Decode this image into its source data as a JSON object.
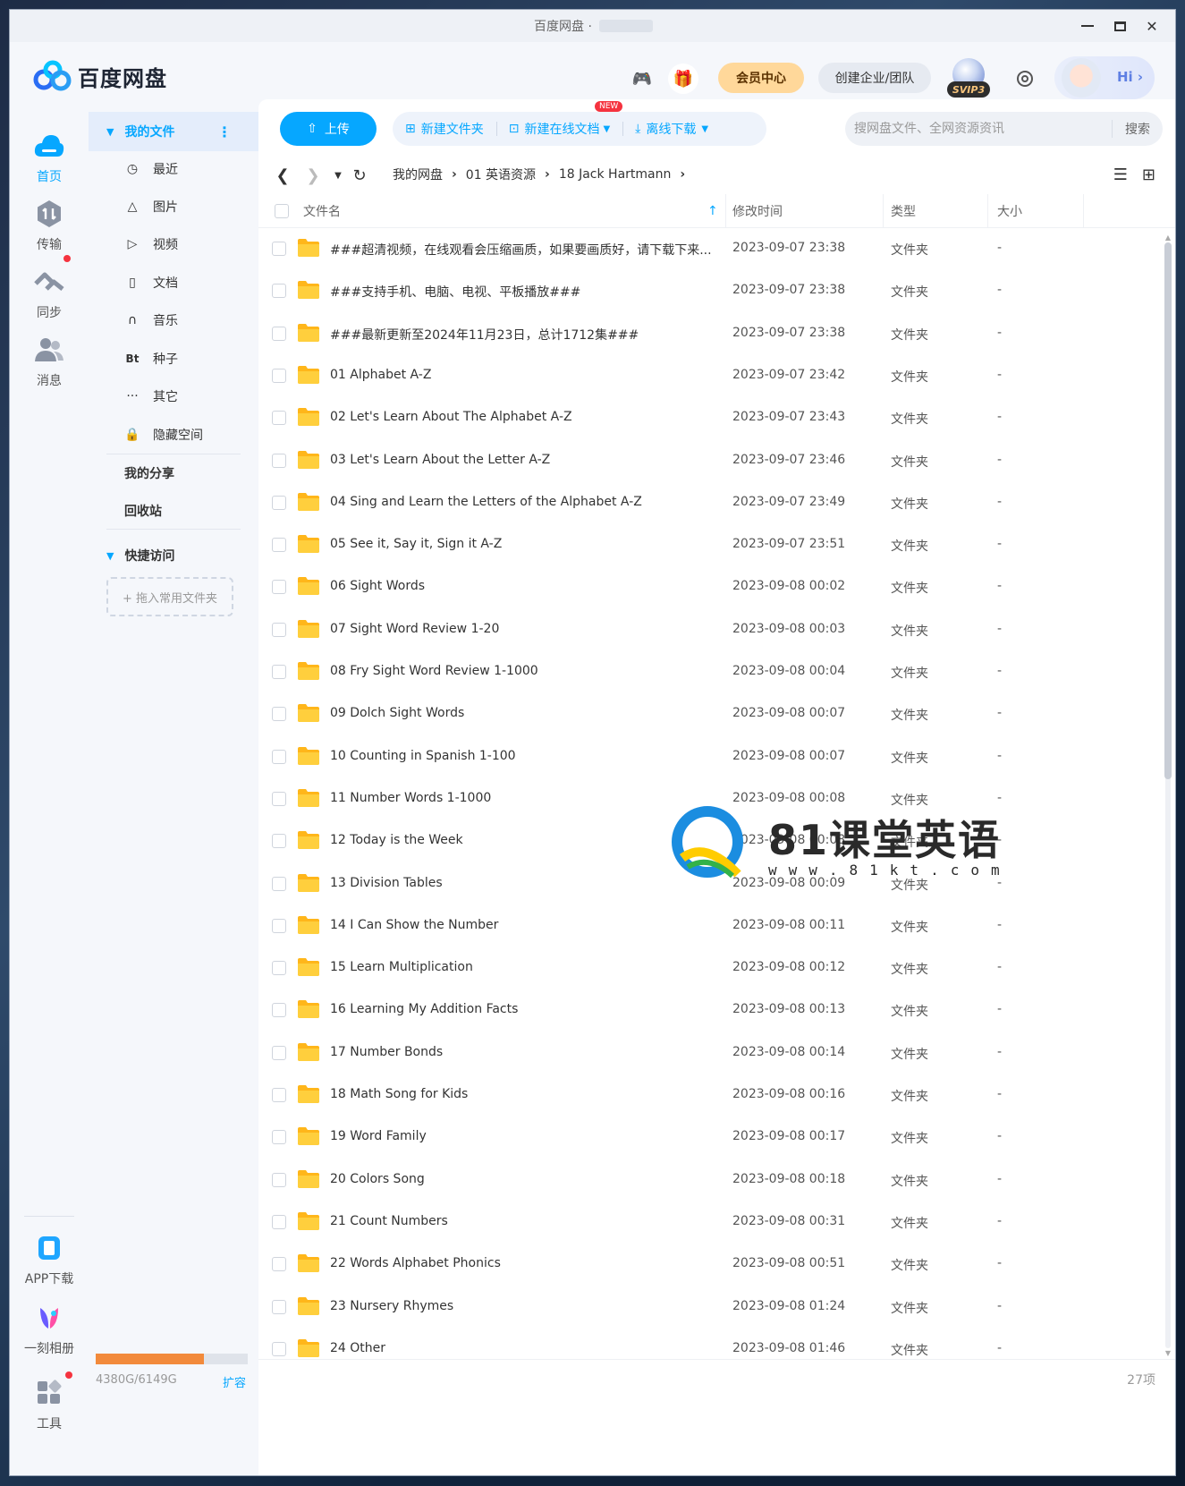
{
  "window": {
    "title": "百度网盘 ·"
  },
  "header": {
    "app_name": "百度网盘",
    "vip_label": "会员中心",
    "team_label": "创建企业/团队",
    "svip_tag": "SVIP3",
    "hi_label": "Hi ›"
  },
  "rail": {
    "items": [
      {
        "label": "首页",
        "icon": "cloud-icon"
      },
      {
        "label": "传输",
        "icon": "transfer-icon"
      },
      {
        "label": "同步",
        "icon": "sync-icon"
      },
      {
        "label": "消息",
        "icon": "message-icon"
      },
      {
        "label": "APP下载",
        "icon": "phone-icon"
      },
      {
        "label": "一刻相册",
        "icon": "album-icon"
      },
      {
        "label": "工具",
        "icon": "tools-icon"
      }
    ]
  },
  "side": {
    "my_files": "我的文件",
    "items": [
      {
        "label": "最近",
        "icon": "clock-icon"
      },
      {
        "label": "图片",
        "icon": "image-icon"
      },
      {
        "label": "视频",
        "icon": "video-icon"
      },
      {
        "label": "文档",
        "icon": "document-icon"
      },
      {
        "label": "音乐",
        "icon": "headphones-icon"
      },
      {
        "label": "种子",
        "icon": "bt-icon",
        "glyph": "Bt"
      },
      {
        "label": "其它",
        "icon": "more-icon"
      },
      {
        "label": "隐藏空间",
        "icon": "lock-icon"
      }
    ],
    "my_share": "我的分享",
    "recycle": "回收站",
    "quick_access": "快捷访问",
    "drop_hint": "+ 拖入常用文件夹",
    "quota_text": "4380G/6149G",
    "quota_used_fraction": 0.712,
    "expand_label": "扩容"
  },
  "toolbar": {
    "upload": "上传",
    "new_folder": "新建文件夹",
    "new_doc": "新建在线文档",
    "new_badge": "NEW",
    "offline": "离线下载",
    "search_placeholder": "搜网盘文件、全网资源资讯",
    "search_button": "搜索"
  },
  "breadcrumb": [
    "我的网盘",
    "01 英语资源",
    "18 Jack Hartmann"
  ],
  "columns": {
    "name": "文件名",
    "mtime": "修改时间",
    "type": "类型",
    "size": "大小"
  },
  "files": [
    {
      "name": "###超清视频，在线观看会压缩画质，如果要画质好，请下载下来...",
      "mtime": "2023-09-07 23:38",
      "type": "文件夹",
      "size": "-"
    },
    {
      "name": "###支持手机、电脑、电视、平板播放###",
      "mtime": "2023-09-07 23:38",
      "type": "文件夹",
      "size": "-"
    },
    {
      "name": "###最新更新至2024年11月23日，总计1712集###",
      "mtime": "2023-09-07 23:38",
      "type": "文件夹",
      "size": "-"
    },
    {
      "name": "01 Alphabet A-Z",
      "mtime": "2023-09-07 23:42",
      "type": "文件夹",
      "size": "-"
    },
    {
      "name": "02 Let's Learn About The Alphabet A-Z",
      "mtime": "2023-09-07 23:43",
      "type": "文件夹",
      "size": "-"
    },
    {
      "name": "03 Let's Learn About the Letter A-Z",
      "mtime": "2023-09-07 23:46",
      "type": "文件夹",
      "size": "-"
    },
    {
      "name": "04 Sing and Learn the Letters of the Alphabet A-Z",
      "mtime": "2023-09-07 23:49",
      "type": "文件夹",
      "size": "-"
    },
    {
      "name": "05 See it, Say it, Sign it A-Z",
      "mtime": "2023-09-07 23:51",
      "type": "文件夹",
      "size": "-"
    },
    {
      "name": "06 Sight Words",
      "mtime": "2023-09-08 00:02",
      "type": "文件夹",
      "size": "-"
    },
    {
      "name": "07 Sight Word Review 1-20",
      "mtime": "2023-09-08 00:03",
      "type": "文件夹",
      "size": "-"
    },
    {
      "name": "08 Fry Sight Word Review 1-1000",
      "mtime": "2023-09-08 00:04",
      "type": "文件夹",
      "size": "-"
    },
    {
      "name": "09 Dolch Sight Words",
      "mtime": "2023-09-08 00:07",
      "type": "文件夹",
      "size": "-"
    },
    {
      "name": "10 Counting in Spanish 1-100",
      "mtime": "2023-09-08 00:07",
      "type": "文件夹",
      "size": "-"
    },
    {
      "name": "11 Number Words 1-1000",
      "mtime": "2023-09-08 00:08",
      "type": "文件夹",
      "size": "-"
    },
    {
      "name": "12 Today is the Week",
      "mtime": "2023-09-08 00:08",
      "type": "文件夹",
      "size": "-"
    },
    {
      "name": "13 Division Tables",
      "mtime": "2023-09-08 00:09",
      "type": "文件夹",
      "size": "-"
    },
    {
      "name": "14 I Can Show the Number",
      "mtime": "2023-09-08 00:11",
      "type": "文件夹",
      "size": "-"
    },
    {
      "name": "15 Learn Multiplication",
      "mtime": "2023-09-08 00:12",
      "type": "文件夹",
      "size": "-"
    },
    {
      "name": "16 Learning My Addition Facts",
      "mtime": "2023-09-08 00:13",
      "type": "文件夹",
      "size": "-"
    },
    {
      "name": "17 Number Bonds",
      "mtime": "2023-09-08 00:14",
      "type": "文件夹",
      "size": "-"
    },
    {
      "name": "18 Math Song for Kids",
      "mtime": "2023-09-08 00:16",
      "type": "文件夹",
      "size": "-"
    },
    {
      "name": "19 Word Family",
      "mtime": "2023-09-08 00:17",
      "type": "文件夹",
      "size": "-"
    },
    {
      "name": "20 Colors Song",
      "mtime": "2023-09-08 00:18",
      "type": "文件夹",
      "size": "-"
    },
    {
      "name": "21 Count Numbers",
      "mtime": "2023-09-08 00:31",
      "type": "文件夹",
      "size": "-"
    },
    {
      "name": "22 Words Alphabet Phonics",
      "mtime": "2023-09-08 00:51",
      "type": "文件夹",
      "size": "-"
    },
    {
      "name": "23 Nursery Rhymes",
      "mtime": "2023-09-08 01:24",
      "type": "文件夹",
      "size": "-"
    },
    {
      "name": "24 Other",
      "mtime": "2023-09-08 01:46",
      "type": "文件夹",
      "size": "-"
    }
  ],
  "footer": {
    "count": "27项"
  },
  "watermark": {
    "title": "81课堂英语",
    "url": "www.81kt.com"
  },
  "colors": {
    "accent": "#06a7ff",
    "folder": "#ffc933",
    "quota": "#f28a3b",
    "badge": "#f5333f"
  }
}
